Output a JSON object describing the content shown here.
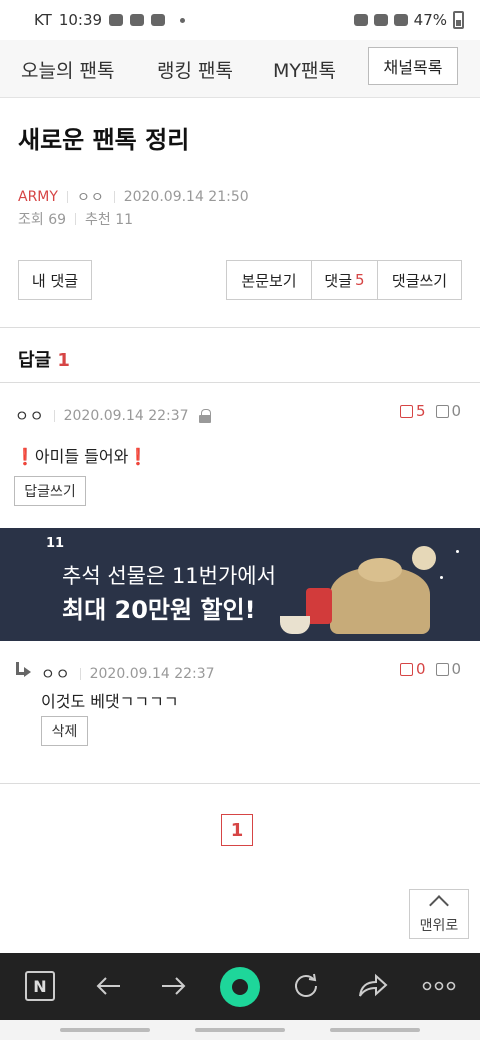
{
  "status_bar": {
    "carrier": "KT",
    "time": "10:39",
    "battery": "47%"
  },
  "top_nav": {
    "tabs": [
      "오늘의 팬톡",
      "랭킹 팬톡",
      "MY팬톡"
    ],
    "channel_button": "채널목록"
  },
  "post": {
    "title": "새로운 팬톡 정리",
    "author_group": "ARMY",
    "author": "ㅇㅇ",
    "datetime": "2020.09.14 21:50",
    "views": "조회 69",
    "recommend": "추천 11"
  },
  "actions": {
    "my_comments": "내 댓글",
    "view_post": "본문보기",
    "comments": "댓글",
    "comment_count": "5",
    "write_comment": "댓글쓰기"
  },
  "replies": {
    "header_label": "답글",
    "header_count": "1",
    "comment1": {
      "nick": "ㅇㅇ",
      "datetime": "2020.09.14 22:37",
      "likes": "5",
      "dislikes": "0",
      "emoji": "❗",
      "text": "아미들 들어와",
      "reply_button": "답글쓰기"
    },
    "comment2": {
      "nick": "ㅇㅇ",
      "datetime": "2020.09.14 22:37",
      "likes": "0",
      "dislikes": "0",
      "text": "이것도 베댓ㄱㄱㄱㄱ",
      "delete_button": "삭제"
    }
  },
  "ad": {
    "logo": "11",
    "line1": "추석 선물은 11번가에서",
    "line2": "최대 20만원 할인!"
  },
  "pagination": {
    "current": "1"
  },
  "to_top": {
    "label": "맨위로"
  },
  "toolbar": {
    "home_icon_letter": "N"
  }
}
